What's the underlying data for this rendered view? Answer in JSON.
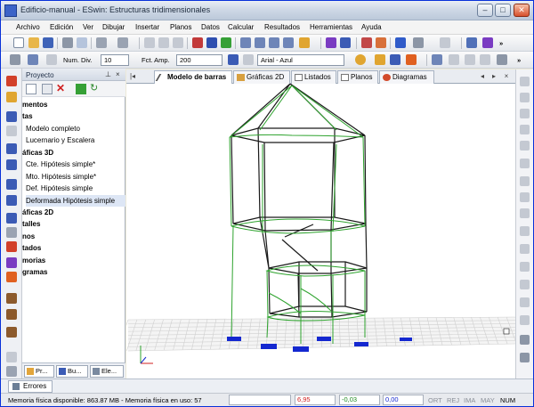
{
  "window": {
    "title": "Edificio-manual - ESwin: Estructuras tridimensionales"
  },
  "menu": [
    "Archivo",
    "Edición",
    "Ver",
    "Dibujar",
    "Insertar",
    "Planos",
    "Datos",
    "Calcular",
    "Resultados",
    "Herramientas",
    "Ayuda"
  ],
  "toolbar2": {
    "num_div_label": "Num. Div.",
    "num_div_value": "10",
    "fct_amp_label": "Fct. Amp.",
    "fct_amp_value": "200",
    "font_value": "Arial - Azul"
  },
  "project_panel": {
    "title": "Proyecto",
    "tree": [
      {
        "label": "mentos",
        "bold": true
      },
      {
        "label": "tas",
        "bold": true
      },
      {
        "label": "Modelo completo",
        "bold": false
      },
      {
        "label": "Lucernario y Escalera",
        "bold": false
      },
      {
        "label": "áficas 3D",
        "bold": true
      },
      {
        "label": "Cte. Hipótesis simple*",
        "bold": false
      },
      {
        "label": "Mto. Hipótesis simple*",
        "bold": false
      },
      {
        "label": "Def. Hipótesis simple",
        "bold": false
      },
      {
        "label": "Deformada Hipótesis simple",
        "bold": false,
        "selected": true
      },
      {
        "label": "áficas 2D",
        "bold": true
      },
      {
        "label": "talles",
        "bold": true
      },
      {
        "label": "nos",
        "bold": true
      },
      {
        "label": "tados",
        "bold": true
      },
      {
        "label": "morias",
        "bold": true
      },
      {
        "label": "gramas",
        "bold": true
      }
    ],
    "tabs": [
      "Pr...",
      "Bu...",
      "Ele..."
    ]
  },
  "doc_tabs": [
    {
      "label": "Modelo de barras",
      "active": true
    },
    {
      "label": "Gráficas 2D",
      "active": false
    },
    {
      "label": "Listados",
      "active": false
    },
    {
      "label": "Planos",
      "active": false
    },
    {
      "label": "Diagramas",
      "active": false
    }
  ],
  "bottom_tab": "Errores",
  "status": {
    "memory": "Memoria física disponible: 863.87 MB - Memoria física en uso: 57",
    "value1": "6,95",
    "value2": "-0,03",
    "value3": "0,00",
    "flags": [
      "ORT",
      "REJ",
      "IMA",
      "MAY",
      "NUM"
    ],
    "flags_active": [
      "NUM"
    ]
  },
  "colors": {
    "model_lines": "#1a1a1a",
    "deformed_lines": "#2ea32e",
    "supports": "#1428d0",
    "accent": "#3c64c8"
  }
}
